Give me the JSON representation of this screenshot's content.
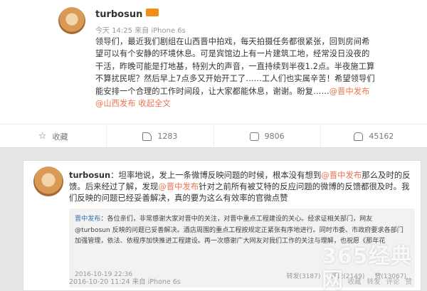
{
  "post": {
    "author": "turbosun",
    "vip_badge": "",
    "meta": "今天 14:25 来自 iPhone 6s",
    "content_before": "领导们，最近我们剧组在山西晋中拍戏，每天拍摄任务都很紧张，回到房间希望可以有个安静的环境休息。可是宾馆边上有一片建筑工地，经常没日没夜的干活，昨晚可能是打地基，特别大的声音，一直持续到半夜1.2点。半夜施工算不算扰民呢？然后早上7点多又开始开工了……工人们也实属辛苦！希望领导们能安排一个合理的工作时间段，让大家都能休息，谢谢。盼复……",
    "mention_1": "@晋中发布",
    "mention_2": "@山西发布",
    "collapse_label": "收起全文",
    "actions": [
      {
        "icon": "star-icon",
        "label": "收藏"
      },
      {
        "icon": "share-icon",
        "label": "1283"
      },
      {
        "icon": "comment-icon",
        "label": "9806"
      },
      {
        "icon": "like-icon",
        "label": "45162"
      }
    ]
  },
  "follow_up": {
    "author": "turbosun",
    "text_before": "：坦率地说，发上一条微博反映问题的时候，根本没有想到",
    "mention": "@晋中发布",
    "text_after": "那么及时的反馈。后来经过了解，发现",
    "mention_2": "@晋中发布",
    "text_after_2": "针对之前所有被艾特的反应问题的微博的反馈都很及时。我们反映的问题已经妥善解决，真的要为这么有效率的官微点赞",
    "date": "2016-10-20 11:24 来自 iPhone 6s",
    "actions": [
      "收藏",
      "转发",
      "评论",
      "赞"
    ]
  },
  "quoted": {
    "author": "晋中发布",
    "text": "：各位亲们，非常感谢大家对晋中的关注，对晋中重点工程建设的关心。经求证相关部门，网友@turbosun 反映的问题已妥善解决。酒店周围的重点工程按规定正紧张有序地进行。同时市委、市政府要求各部门加强管理，依法、依程序加快推进工程建设。再一次感谢广大网友对我们工作的关注与理解，也祝愿《那年花",
    "date": "2016-10-19 22:36",
    "counts": [
      "转发(3187)",
      "评论(2149)",
      "赞(13067)"
    ]
  },
  "watermark": {
    "big": "365经典网",
    "small": ""
  }
}
